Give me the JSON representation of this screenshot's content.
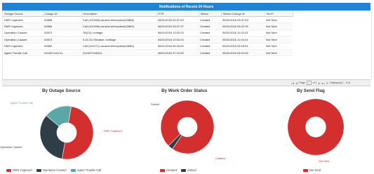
{
  "panel": {
    "title": "Notifications of Recent 24 Hours"
  },
  "grid": {
    "columns": [
      "Outage Source",
      "Outage ID",
      "Description",
      "ETR",
      "Status",
      "Status Change At",
      "Sent?"
    ],
    "rows": [
      [
        "DMS Captured",
        "02868",
        "Call (101498) caused interruption(02868)",
        "06/01/2016 05:37:53",
        "Created",
        "05/31/2016 05:37:53",
        "Not Sent"
      ],
      [
        "DMS Captured",
        "02869",
        "Call (101498) caused interruption(02869)",
        "06/01/2016 05:37:37",
        "Created",
        "05/31/2016 05:22:35",
        "Not Sent"
      ],
      [
        "Operation Caused",
        "02872",
        "TA(23)->voltage",
        "06/01/2016 13:02:23",
        "Created",
        "05/31/2016 11:02:23",
        "Not Sent"
      ],
      [
        "Operation Caused",
        "02874",
        "3.16.311 Breaker->voltage",
        "06/01/2016 13:04:24",
        "Created",
        "05/31/2016 11:04:24",
        "Not Sent"
      ],
      [
        "DMS Captured",
        "02882",
        "Call (101071) caused interruption(02882)",
        "06/01/2016 05:18:52",
        "Created",
        "05/31/2016 05:18:51",
        "Not Sent"
      ],
      [
        "Agent Trouble Call",
        "20160710/1/11",
        "20160710/0011",
        "06/01/2016 07:10:00",
        "Created",
        "05/31/2016 05:10:00",
        "Not Sent"
      ]
    ]
  },
  "pager": {
    "page_label": "Page",
    "page_value": "1",
    "of_label": "of 1",
    "display_text": "Displaying 1 - 6 of"
  },
  "charts": [
    {
      "title": "By Outage Source",
      "slices": [
        {
          "label": "DMS Captured",
          "value": 50,
          "color": "#d32f2f"
        },
        {
          "label": "Operation Caused",
          "value": 33.3,
          "color": "#2f3e46"
        },
        {
          "label": "Agent Trouble Call",
          "value": 16.7,
          "color": "#5aa7a8"
        }
      ]
    },
    {
      "title": "By Work Order Status",
      "slices": [
        {
          "label": "Created",
          "value": 97,
          "color": "#d32f2f"
        },
        {
          "label": "Solved",
          "value": 3,
          "color": "#2f3e46"
        }
      ]
    },
    {
      "title": "By Send Flag",
      "slices": [
        {
          "label": "Not Sent",
          "value": 100,
          "color": "#d32f2f"
        }
      ]
    }
  ],
  "legends": [
    [
      "DMS Captured",
      "Operation Caused",
      "Agent Trouble Call"
    ],
    [
      "Created",
      "Solved"
    ],
    [
      "Not Sent"
    ]
  ]
}
